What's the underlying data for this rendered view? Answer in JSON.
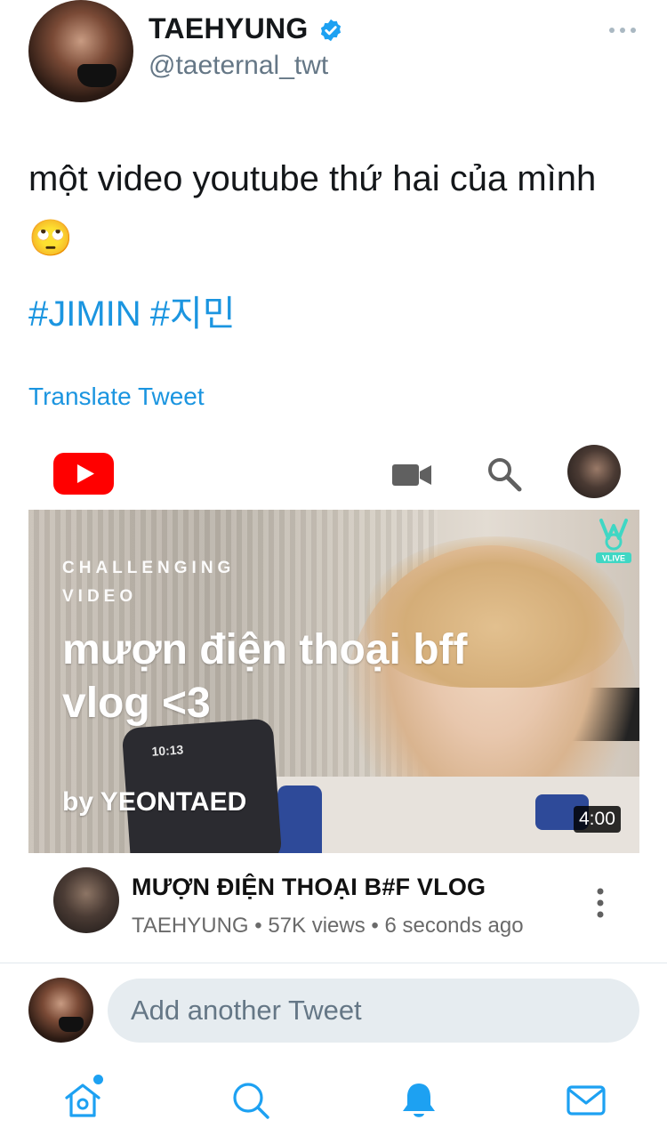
{
  "tweet": {
    "author_name": "TAEHYUNG",
    "author_handle": "@taeternal_twt",
    "text": "một video youtube thứ hai của mình 🙄",
    "hashtags": [
      "#JIMIN",
      "#지민"
    ],
    "translate_label": "Translate Tweet"
  },
  "youtube_card": {
    "thumbnail": {
      "tag_line1": "CHALLENGING",
      "tag_line2": "VIDEO",
      "headline": "mượn điện thoại bff vlog <3",
      "byline": "by YEONTAED",
      "phone_time": "10:13",
      "duration": "4:00",
      "badge": "VLIVE"
    },
    "video_title": "MƯỢN ĐIỆN THOẠI B#F VLOG",
    "channel": "TAEHYUNG",
    "views": "57K views",
    "age": "6 seconds ago"
  },
  "reply": {
    "placeholder": "Add another Tweet"
  },
  "colors": {
    "accent": "#1b95e0",
    "youtube_red": "#ff0000",
    "secondary_text": "#657786"
  },
  "icons": {
    "header": [
      "verified-badge-icon",
      "more-icon"
    ],
    "card": [
      "youtube-logo-icon",
      "camera-icon",
      "search-icon",
      "kebab-icon"
    ],
    "tabbar": [
      "home-icon",
      "search-icon",
      "notifications-bell-icon",
      "mail-icon"
    ]
  }
}
